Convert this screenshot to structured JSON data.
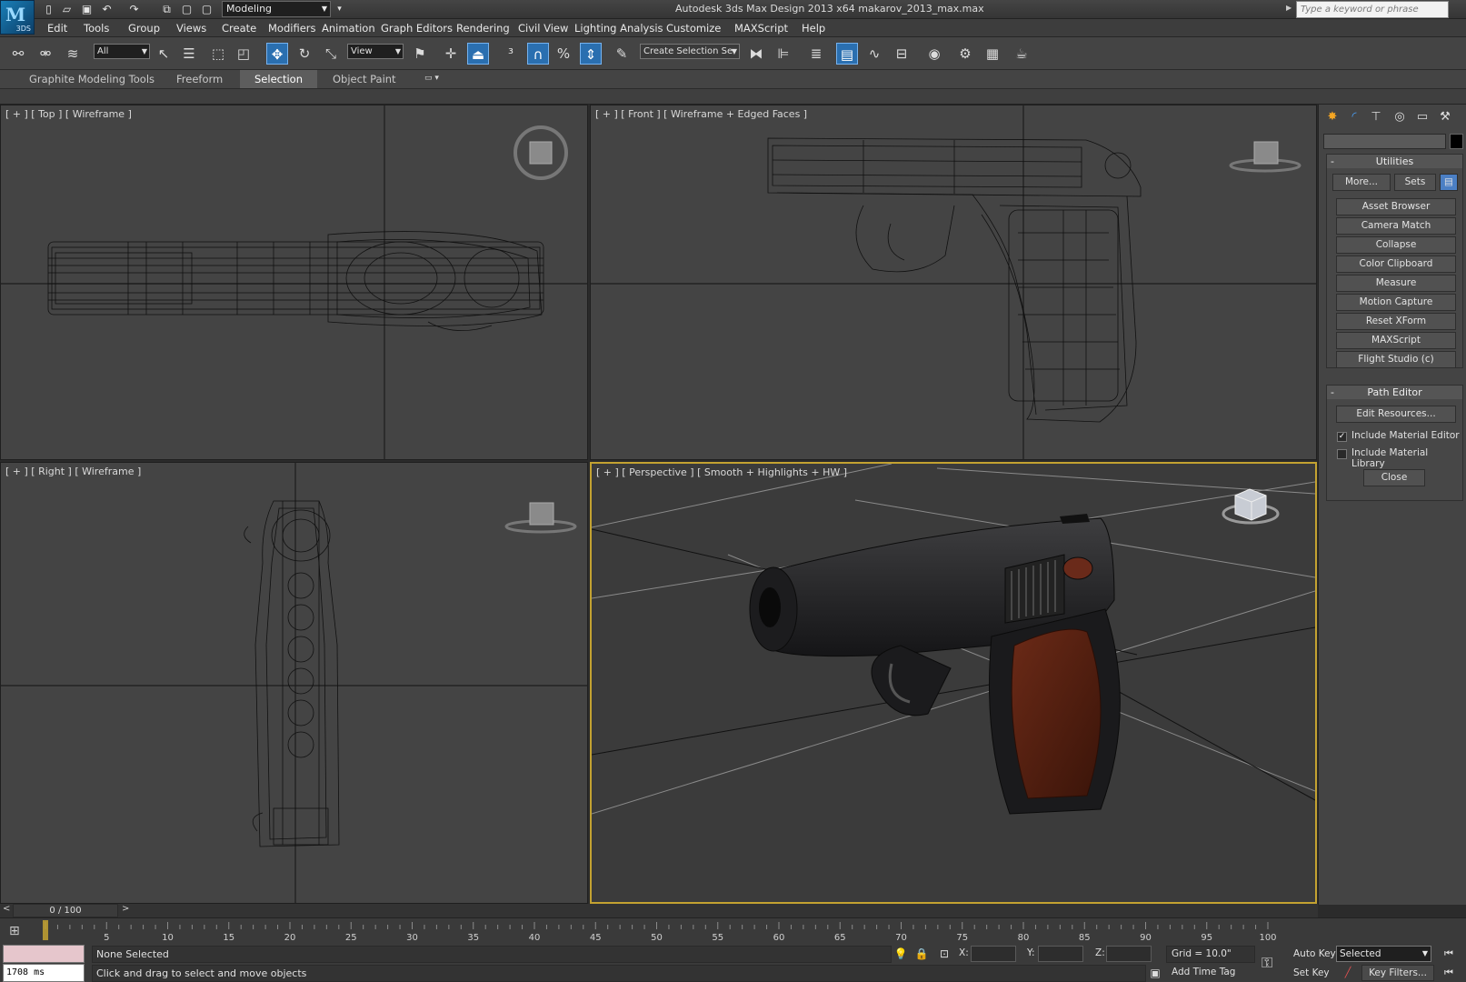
{
  "titlebar": {
    "logo_text": "M",
    "logo_sub": "3DS",
    "workspace": "Modeling",
    "title": "Autodesk 3ds Max Design 2013 x64      makarov_2013_max.max",
    "search_placeholder": "Type a keyword or phrase"
  },
  "menu": [
    "Edit",
    "Tools",
    "Group",
    "Views",
    "Create",
    "Modifiers",
    "Animation",
    "Graph Editors",
    "Rendering",
    "Civil View",
    "Lighting Analysis",
    "Customize",
    "MAXScript",
    "Help"
  ],
  "toolbar": {
    "filter": "All",
    "ref_coord": "View",
    "named_selection": "Create Selection Se"
  },
  "ribbon": {
    "tabs": [
      "Graphite Modeling Tools",
      "Freeform",
      "Selection",
      "Object Paint"
    ],
    "active_tab": "Selection"
  },
  "viewports": {
    "top": {
      "label": "[ + ] [ Top ] [ Wireframe ]",
      "cube": "TOP"
    },
    "front": {
      "label": "[ + ] [ Front ] [ Wireframe + Edged Faces ]",
      "cube": "FRONT"
    },
    "right": {
      "label": "[ + ] [ Right ] [ Wireframe ]",
      "cube": "RIGHT"
    },
    "perspective": {
      "label": "[ + ] [ Perspective ] [ Smooth + Highlights + HW ]"
    }
  },
  "command_panel": {
    "utilities": {
      "title": "Utilities",
      "more": "More...",
      "sets": "Sets",
      "buttons": [
        "Asset Browser",
        "Camera Match",
        "Collapse",
        "Color Clipboard",
        "Measure",
        "Motion Capture",
        "Reset XForm",
        "MAXScript",
        "Flight Studio (c)"
      ]
    },
    "path_editor": {
      "title": "Path Editor",
      "edit_resources": "Edit Resources...",
      "include_material_editor": "Include Material Editor",
      "include_material_editor_checked": true,
      "include_material_library": "Include Material Library",
      "include_material_library_checked": false,
      "close": "Close"
    }
  },
  "timeline": {
    "frame": "0 / 100",
    "ticks": [
      "5",
      "10",
      "15",
      "20",
      "25",
      "30",
      "35",
      "40",
      "45",
      "50",
      "55",
      "60",
      "65",
      "70",
      "75",
      "80",
      "85",
      "90",
      "95",
      "100"
    ]
  },
  "status": {
    "maxscript_output": "1708 ms",
    "selection": "None Selected",
    "prompt": "Click and drag to select and move objects",
    "x_label": "X:",
    "y_label": "Y:",
    "z_label": "Z:",
    "grid": "Grid = 10.0\"",
    "add_time_tag": "Add Time Tag",
    "auto_key": "Auto Key",
    "set_key": "Set Key",
    "key_mode": "Selected",
    "key_filters": "Key Filters..."
  },
  "colors": {
    "active_viewport_border": "#c3a231",
    "active_tool": "#2a6fb0",
    "viewport_bg": "#444444"
  }
}
